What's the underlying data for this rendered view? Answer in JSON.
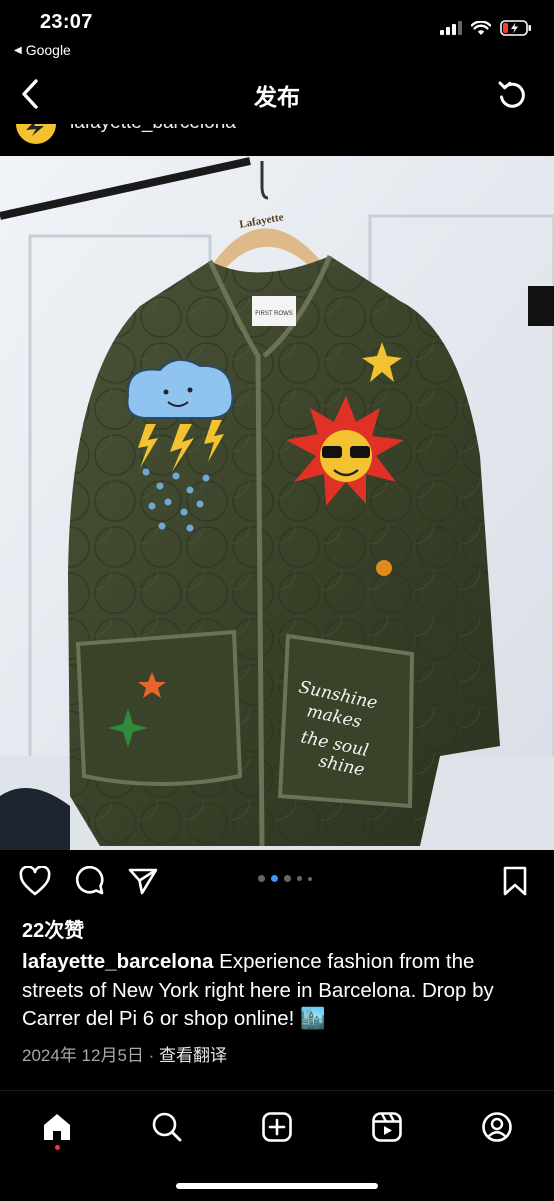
{
  "status_bar": {
    "time": "23:07",
    "back_app": "Google",
    "back_app_icon": "left-triangle",
    "signal_icon": "signal-icon",
    "wifi_icon": "wifi-icon",
    "battery_icon": "battery-charging-icon",
    "battery_color": "#ff3b30"
  },
  "nav": {
    "title": "发布",
    "back_icon": "chevron-left-icon",
    "refresh_icon": "refresh-icon"
  },
  "post": {
    "username": "lafayette_barcelona",
    "photo": {
      "hanger_brand": "Lafayette",
      "collar_label": "FIRST ROWS",
      "pocket_embroidery": [
        "Sunshine",
        "makes",
        "the soul",
        "shine"
      ]
    },
    "carousel": {
      "count": 5,
      "active_index": 1
    },
    "likes": "22次赞",
    "caption": "Experience fashion from the streets of New York right here in Barcelona. Drop by Carrer del Pi 6 or shop online! 🏙️",
    "date": "2024年 12月5日",
    "separator": "·",
    "translate": "查看翻译"
  },
  "actions": {
    "like_icon": "heart-icon",
    "comment_icon": "comment-icon",
    "share_icon": "send-icon",
    "save_icon": "bookmark-icon"
  },
  "tabbar": {
    "home_icon": "home-icon",
    "search_icon": "search-icon",
    "create_icon": "plus-square-icon",
    "reels_icon": "reels-icon",
    "profile_icon": "profile-icon",
    "notification_color": "#ff3040"
  }
}
